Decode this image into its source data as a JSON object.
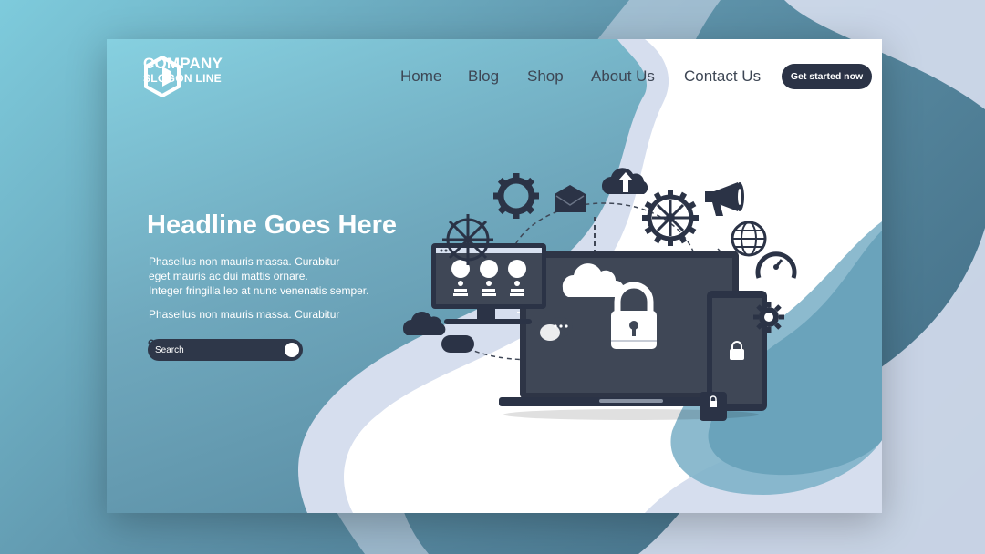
{
  "brand": {
    "name": "COMPANY",
    "slogan": "SLOGON LINE"
  },
  "nav": {
    "items": [
      "Home",
      "Blog",
      "Shop",
      "About Us",
      "Contact Us"
    ],
    "cta_label": "Get started now"
  },
  "hero": {
    "headline": "Headline Goes Here",
    "body_lines": [
      "Phasellus non mauris massa.  Curabitur",
      "eget mauris ac dui mattis ornare.",
      "Integer fringilla leo at nunc venenatis semper."
    ],
    "body_extra": "Phasellus non mauris massa.  Curabitur"
  },
  "search": {
    "label": "Search"
  },
  "colors": {
    "dark": "#2b3346",
    "device": "#3f4756",
    "accent_light": "#d8e1f0"
  },
  "icons": [
    "hexagon-logo-icon",
    "search-icon",
    "gear-icon",
    "envelope-icon",
    "cloud-upload-icon",
    "megaphone-icon",
    "globe-icon",
    "speedometer-icon",
    "cloud-icon",
    "padlock-icon",
    "chat-icon"
  ]
}
